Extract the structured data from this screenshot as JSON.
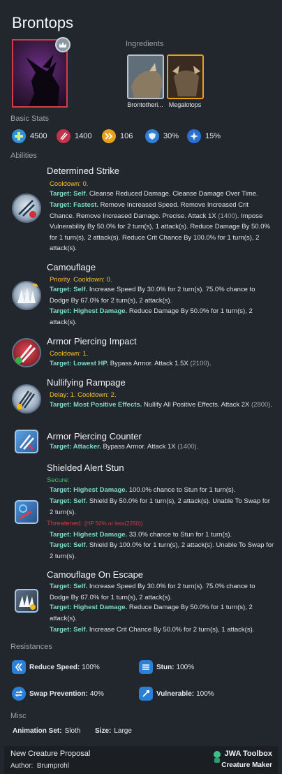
{
  "creature": {
    "name": "Brontops"
  },
  "ingredients": {
    "label": "Ingredients",
    "items": [
      {
        "name": "Brontotheri...",
        "rarity_color": "#b9c2cb"
      },
      {
        "name": "Megalotops",
        "rarity_color": "#e8a21a"
      }
    ]
  },
  "basic_stats": {
    "label": "Basic Stats",
    "items": [
      {
        "icon": "health-icon",
        "value": "4500",
        "color": "#2f8fd8"
      },
      {
        "icon": "damage-icon",
        "value": "1400",
        "color": "#c0334a"
      },
      {
        "icon": "speed-icon",
        "value": "106",
        "color": "#e6a21c"
      },
      {
        "icon": "armor-icon",
        "value": "30%",
        "color": "#2f7fd6"
      },
      {
        "icon": "crit-icon",
        "value": "15%",
        "color": "#2b6fd0"
      }
    ]
  },
  "abilities": {
    "label": "Abilities",
    "items": [
      {
        "name": "Determined Strike",
        "icon": "strike-icon",
        "cooldown": "Cooldown: 0.",
        "effects": [
          {
            "target": "Target: Self.",
            "text": " Cleanse Reduced Damage. Cleanse Damage Over Time."
          },
          {
            "target": "Target: Fastest.",
            "text": " Remove Increased Speed. Remove Increased Crit Chance. Remove Increased Damage. Precise. Attack 1X ",
            "num": "(1400)",
            "text2": ". Impose Vulnerability By 50.0% for 2 turn(s), 1 attack(s). Reduce Damage By 50.0% for 1 turn(s), 2 attack(s). Reduce Crit Chance By 100.0% for 1 turn(s), 2 attack(s)."
          }
        ]
      },
      {
        "name": "Camouflage",
        "icon": "camouflage-icon",
        "cooldown": "Priority. Cooldown: 0.",
        "effects": [
          {
            "target": "Target: Self.",
            "text": " Increase Speed By 30.0% for 2 turn(s). 75.0% chance to Dodge By 67.0% for 2 turn(s), 2 attack(s)."
          },
          {
            "target": "Target: Highest Damage.",
            "text": " Reduce Damage By 50.0% for 1 turn(s), 2 attack(s)."
          }
        ]
      },
      {
        "name": "Armor Piercing Impact",
        "icon": "armor-piercing-impact-icon",
        "cooldown": "Cooldown: 1.",
        "effects": [
          {
            "target": "Target: Lowest HP.",
            "text": " Bypass Armor. Attack 1.5X ",
            "num": "(2100)",
            "text2": "."
          }
        ]
      },
      {
        "name": "Nullifying Rampage",
        "icon": "nullifying-rampage-icon",
        "cooldown": "Delay: 1. Cooldown: 2.",
        "effects": [
          {
            "target": "Target: Most Positive Effects.",
            "text": " Nullify All Positive Effects. Attack 2X ",
            "num": "(2800)",
            "text2": "."
          }
        ]
      },
      {
        "name": "Armor Piercing Counter",
        "icon": "counter-icon",
        "effects": [
          {
            "target": "Target: Attacker.",
            "text": " Bypass Armor. Attack 1X ",
            "num": "(1400)",
            "text2": "."
          }
        ]
      },
      {
        "name": "Shielded Alert Stun",
        "icon": "alert-icon",
        "secure_label": "Secure:",
        "secure_effects": [
          {
            "target": "Target: Highest Damage.",
            "text": " 100.0% chance to Stun for 1 turn(s)."
          },
          {
            "target": "Target: Self.",
            "text": " Shield By 50.0% for 1 turn(s), 2 attack(s). Unable To Swap for 2 turn(s)."
          }
        ],
        "threatened_label": "Threatened:",
        "threatened_cond": "(HP 50% or less(2250))",
        "threatened_effects": [
          {
            "target": "Target: Highest Damage.",
            "text": " 33.0% chance to Stun for 1 turn(s)."
          },
          {
            "target": "Target: Self.",
            "text": " Shield By 100.0% for 1 turn(s), 2 attack(s). Unable To Swap for 2 turn(s)."
          }
        ]
      },
      {
        "name": "Camouflage On Escape",
        "icon": "escape-icon",
        "effects": [
          {
            "target": "Target: Self.",
            "text": " Increase Speed By 30.0% for 2 turn(s). 75.0% chance to Dodge By 67.0% for 1 turn(s), 2 attack(s)."
          },
          {
            "target": "Target: Highest Damage.",
            "text": " Reduce Damage By 50.0% for 1 turn(s), 2 attack(s)."
          },
          {
            "target": "Target: Self.",
            "text": " Increase Crit Chance By 50.0% for 2 turn(s), 1 attack(s)."
          }
        ]
      }
    ]
  },
  "resistances": {
    "label": "Resistances",
    "items": [
      {
        "icon": "reduce-speed-icon",
        "name": "Reduce Speed:",
        "value": "100%"
      },
      {
        "icon": "stun-icon",
        "name": "Stun:",
        "value": "100%"
      },
      {
        "icon": "swap-prevention-icon",
        "name": "Swap Prevention:",
        "value": "40%"
      },
      {
        "icon": "vulnerable-icon",
        "name": "Vulnerable:",
        "value": "100%"
      }
    ]
  },
  "misc": {
    "label": "Misc",
    "animation_label": "Animation Set:",
    "animation_value": "Sloth",
    "size_label": "Size:",
    "size_value": "Large"
  },
  "footer": {
    "proposal": "New Creature Proposal",
    "author_label": "Author:",
    "author": "Brumprohl",
    "brand": "JWA Toolbox",
    "sub": "Creature Maker"
  }
}
